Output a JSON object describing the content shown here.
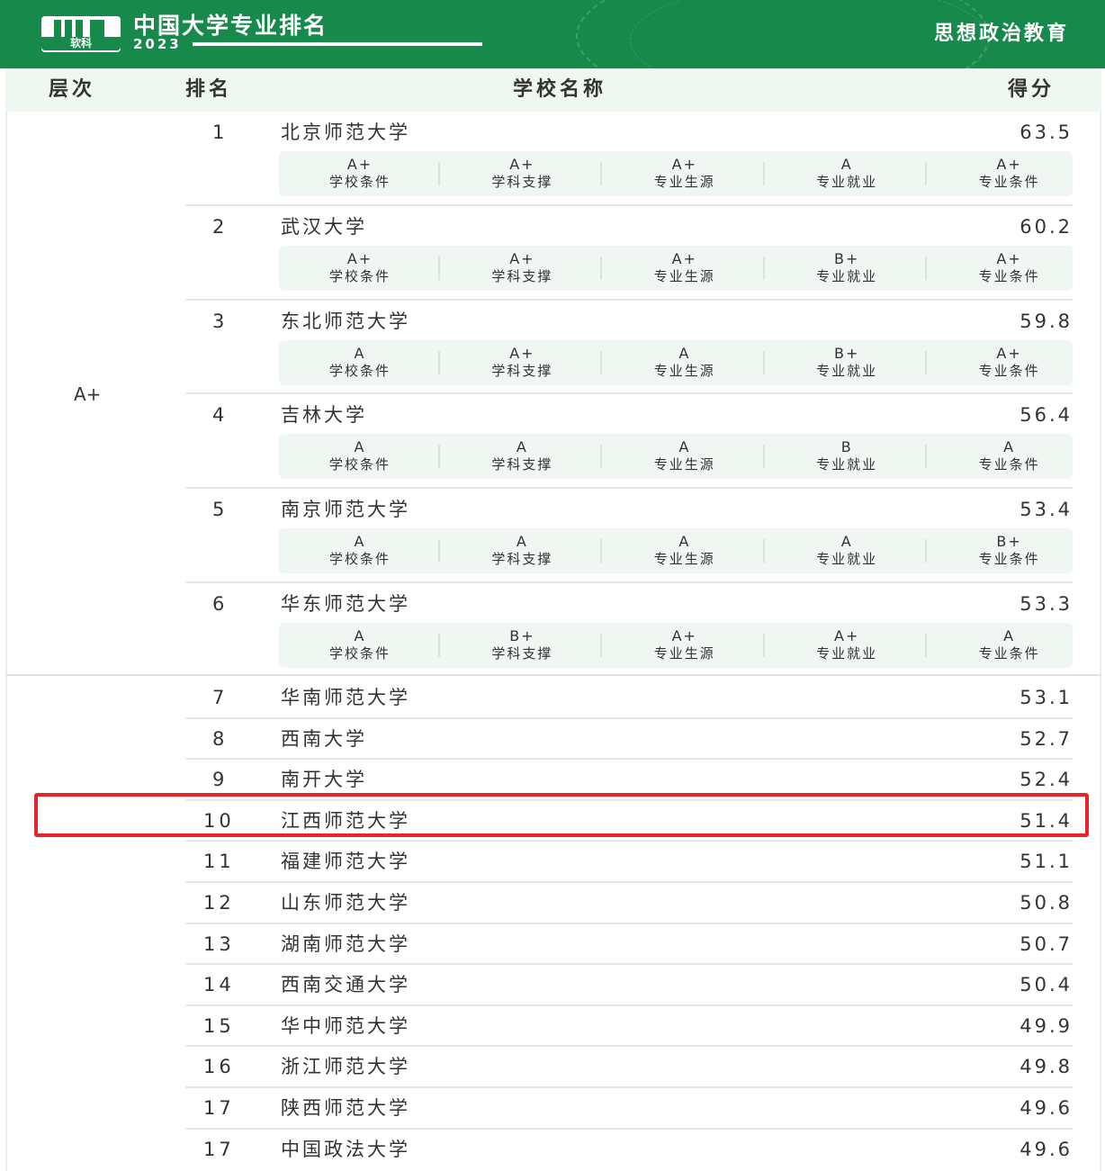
{
  "header": {
    "logo_text": "软科",
    "title": "中国大学专业排名",
    "year": "2023",
    "subject": "思想政治教育",
    "bg_color": "#17894a"
  },
  "columns": {
    "level": "层次",
    "rank": "排名",
    "school": "学校名称",
    "score": "得分"
  },
  "level_label": "A+",
  "detail_labels": [
    "学校条件",
    "学科支撑",
    "专业生源",
    "专业就业",
    "专业条件"
  ],
  "detailed_rows": [
    {
      "rank": "1",
      "school": "北京师范大学",
      "score": "63.5",
      "grades": [
        "A+",
        "A+",
        "A+",
        "A",
        "A+"
      ]
    },
    {
      "rank": "2",
      "school": "武汉大学",
      "score": "60.2",
      "grades": [
        "A+",
        "A+",
        "A+",
        "B+",
        "A+"
      ]
    },
    {
      "rank": "3",
      "school": "东北师范大学",
      "score": "59.8",
      "grades": [
        "A",
        "A+",
        "A",
        "B+",
        "A+"
      ]
    },
    {
      "rank": "4",
      "school": "吉林大学",
      "score": "56.4",
      "grades": [
        "A",
        "A",
        "A",
        "B",
        "A"
      ]
    },
    {
      "rank": "5",
      "school": "南京师范大学",
      "score": "53.4",
      "grades": [
        "A",
        "A",
        "A",
        "A",
        "B+"
      ]
    },
    {
      "rank": "6",
      "school": "华东师范大学",
      "score": "53.3",
      "grades": [
        "A",
        "B+",
        "A+",
        "A+",
        "A"
      ]
    }
  ],
  "simple_rows": [
    {
      "rank": "7",
      "school": "华南师范大学",
      "score": "53.1"
    },
    {
      "rank": "8",
      "school": "西南大学",
      "score": "52.7"
    },
    {
      "rank": "9",
      "school": "南开大学",
      "score": "52.4"
    },
    {
      "rank": "10",
      "school": "江西师范大学",
      "score": "51.4"
    },
    {
      "rank": "11",
      "school": "福建师范大学",
      "score": "51.1"
    },
    {
      "rank": "12",
      "school": "山东师范大学",
      "score": "50.8"
    },
    {
      "rank": "13",
      "school": "湖南师范大学",
      "score": "50.7"
    },
    {
      "rank": "14",
      "school": "西南交通大学",
      "score": "50.4"
    },
    {
      "rank": "15",
      "school": "华中师范大学",
      "score": "49.9"
    },
    {
      "rank": "16",
      "school": "浙江师范大学",
      "score": "49.8"
    },
    {
      "rank": "17",
      "school": "陕西师范大学",
      "score": "49.6"
    },
    {
      "rank": "17",
      "school": "中国政法大学",
      "score": "49.6"
    }
  ],
  "highlighted_rank": "10",
  "highlight_color": "#e8242a"
}
